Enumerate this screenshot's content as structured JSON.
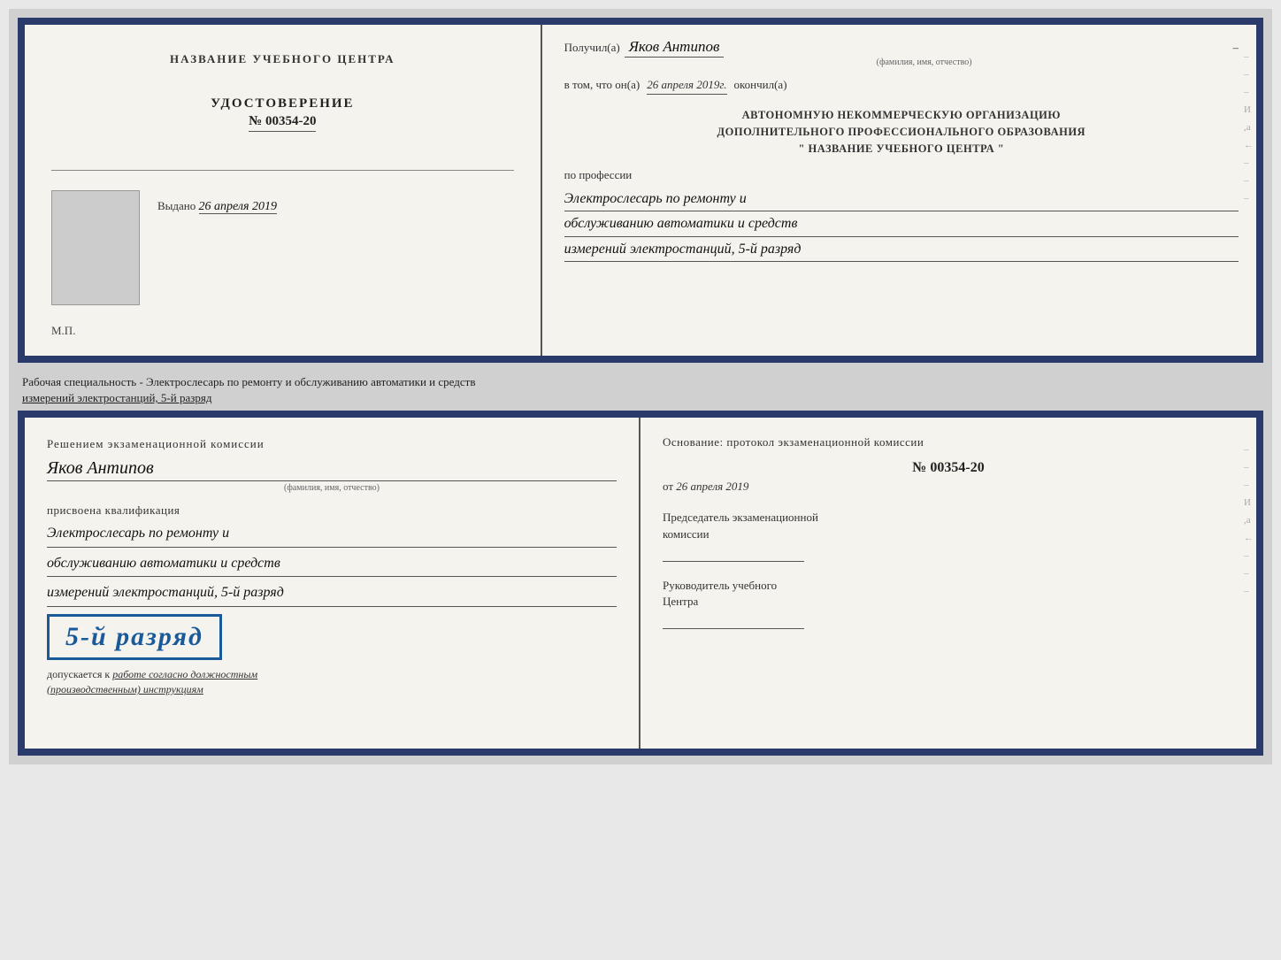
{
  "top_document": {
    "left": {
      "title": "НАЗВАНИЕ УЧЕБНОГО ЦЕНТРА",
      "section_label": "УДОСТОВЕРЕНИЕ",
      "number": "№ 00354-20",
      "vydano_label": "Выдано",
      "vydano_date": "26 апреля 2019",
      "mp_label": "М.П."
    },
    "right": {
      "poluchil_label": "Получил(а)",
      "recipient_name": "Яков Антипов",
      "fio_hint": "(фамилия, имя, отчество)",
      "v_tom_label": "в том, что он(а)",
      "date_text": "26 апреля 2019г.",
      "okonchil_label": "окончил(а)",
      "org_line1": "АВТОНОМНУЮ НЕКОММЕРЧЕСКУЮ ОРГАНИЗАЦИЮ",
      "org_line2": "ДОПОЛНИТЕЛЬНОГО ПРОФЕССИОНАЛЬНОГО ОБРАЗОВАНИЯ",
      "org_name": "\"   НАЗВАНИЕ УЧЕБНОГО ЦЕНТРА   \"",
      "po_professii_label": "по профессии",
      "profession_line1": "Электрослесарь по ремонту и",
      "profession_line2": "обслуживанию автоматики и средств",
      "profession_line3": "измерений электростанций, 5-й разряд"
    }
  },
  "between_text_line1": "Рабочая специальность - Электрослесарь по ремонту и обслуживанию автоматики и средств",
  "between_text_line2_underlined": "измерений электростанций, 5-й разряд",
  "bottom_document": {
    "left": {
      "resheniem_label": "Решением экзаменационной комиссии",
      "person_name": "Яков Антипов",
      "fio_hint": "(фамилия, имя, отчество)",
      "prisvoena_label": "присвоена квалификация",
      "qual_line1": "Электрослесарь по ремонту и",
      "qual_line2": "обслуживанию автоматики и средств",
      "qual_line3": "измерений электростанций, 5-й разряд",
      "rank_badge_text": "5-й разряд",
      "dopuskaetsya_prefix": "допускается к",
      "dopuskaetsya_hw": "работе согласно должностным",
      "dopuskaetsya_hw2": "(производственным) инструкциям"
    },
    "right": {
      "osnovanie_label": "Основание: протокол экзаменационной комиссии",
      "protocol_number": "№ 00354-20",
      "ot_label": "от",
      "ot_date": "26 апреля 2019",
      "predsedatel_label": "Председатель экзаменационной",
      "predsedatel_label2": "комиссии",
      "rukovoditel_label": "Руководитель учебного",
      "rukovoditel_label2": "Центра"
    }
  },
  "side_marks": {
    "right_marks": [
      "–",
      "–",
      "–",
      "И",
      ",а",
      "←",
      "–",
      "–",
      "–"
    ]
  }
}
